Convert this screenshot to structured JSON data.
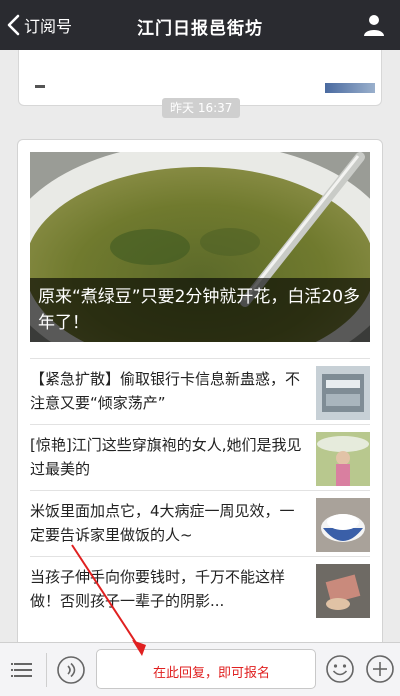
{
  "navbar": {
    "back_label": "订阅号",
    "title": "江门日报邑街坊",
    "back_icon": "chevron-left-icon",
    "profile_icon": "person-icon"
  },
  "timestamp": "昨天 16:37",
  "cover": {
    "title": "原来“煮绿豆”只要2分钟就开花，白活20多年了！"
  },
  "articles": [
    {
      "title": "【紧急扩散】偷取银行卡信息新蛊惑，不注意又要“倾家荡产”"
    },
    {
      "title": "[惊艳]江门这些穿旗袍的女人,她们是我见过最美的"
    },
    {
      "title": "米饭里面加点它，4大病症一周见效，一定要告诉家里做饭的人~"
    },
    {
      "title": "当孩子伸手向你要钱时，千万不能这样做！否则孩子一辈子的阴影..."
    }
  ],
  "toolbar": {
    "input_hint": "在此回复，即可报名",
    "menu_icon": "menu-icon",
    "voice_icon": "voice-icon",
    "emoji_icon": "emoji-icon",
    "plus_icon": "plus-icon"
  },
  "colors": {
    "navbar_bg": "#2a2b30",
    "chat_bg": "#ebebeb",
    "annotation_red": "#e02020"
  }
}
